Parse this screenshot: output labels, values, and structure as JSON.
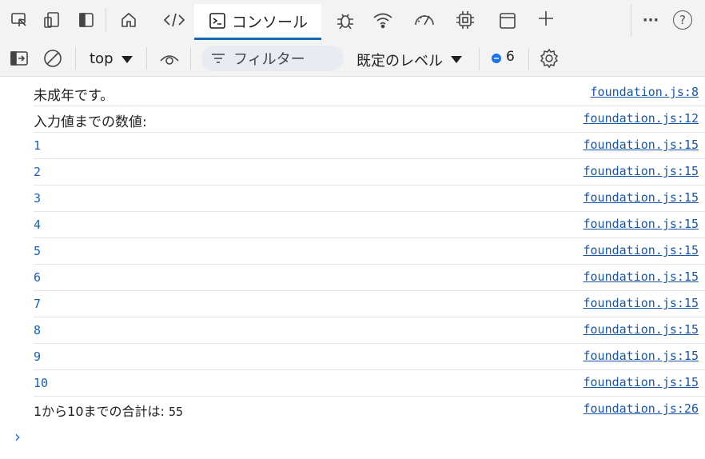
{
  "tabbar": {
    "active_tab_label": "コンソール",
    "icons": [
      "inspect-icon",
      "device-emulation-icon",
      "dock-icon",
      "welcome-home-icon",
      "elements-icon",
      "console-icon",
      "sources-bug-icon",
      "network-wifi-icon",
      "performance-gauge-icon",
      "memory-chip-icon",
      "application-window-icon",
      "add-tab-icon",
      "more-icon",
      "help-icon"
    ],
    "more_label": "···",
    "help_label": "?"
  },
  "toolbar": {
    "context": "top",
    "filter_placeholder": "フィルター",
    "level_label": "既定のレベル",
    "issues_count": "6"
  },
  "console": {
    "rows": [
      {
        "message": "未成年です。",
        "source": "foundation.js:8"
      },
      {
        "message": "入力値までの数値:",
        "source": "foundation.js:12"
      },
      {
        "message": "1",
        "source": "foundation.js:15"
      },
      {
        "message": "2",
        "source": "foundation.js:15"
      },
      {
        "message": "3",
        "source": "foundation.js:15"
      },
      {
        "message": "4",
        "source": "foundation.js:15"
      },
      {
        "message": "5",
        "source": "foundation.js:15"
      },
      {
        "message": "6",
        "source": "foundation.js:15"
      },
      {
        "message": "7",
        "source": "foundation.js:15"
      },
      {
        "message": "8",
        "source": "foundation.js:15"
      },
      {
        "message": "9",
        "source": "foundation.js:15"
      },
      {
        "message": "10",
        "source": "foundation.js:15"
      },
      {
        "message": "1から10までの合計は:",
        "value": "55",
        "source": "foundation.js:26"
      }
    ],
    "prompt": "›"
  },
  "colors": {
    "accent": "#0f6cbd",
    "link": "#1a56a8",
    "number": "#1a5fb4",
    "toolbar_bg": "#f3f3f3"
  }
}
